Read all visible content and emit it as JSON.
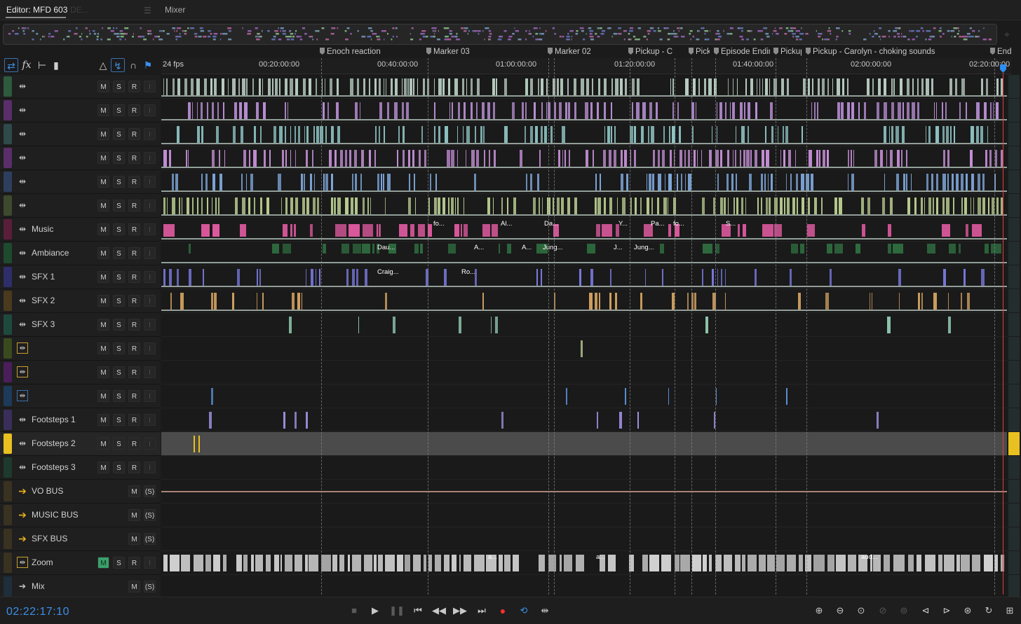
{
  "tabs": [
    {
      "label": "Editor: MFD 603",
      "active": true
    },
    {
      "label": "DE...",
      "active": false
    },
    {
      "label": "Mixer",
      "active": false
    }
  ],
  "header_tools": [
    {
      "icon": "switch-arrows-icon"
    },
    {
      "icon": "fx-icon",
      "label": "fx"
    },
    {
      "icon": "send-icon"
    },
    {
      "icon": "meter-bars-icon"
    },
    {
      "icon": "warning-triangle-icon"
    },
    {
      "icon": "input-monitor-icon"
    },
    {
      "icon": "headphones-icon"
    },
    {
      "icon": "marker-pin-icon"
    }
  ],
  "ruler": {
    "fps_label": "24 fps",
    "ticks": [
      "00:20:00:00",
      "00:40:00:00",
      "01:00:00:00",
      "01:20:00:00",
      "01:40:00:00",
      "02:00:00:00",
      "02:20:00:00"
    ]
  },
  "markers": [
    {
      "label": "Enoch reaction"
    },
    {
      "label": "Marker 03"
    },
    {
      "label": "Marker 02"
    },
    {
      "label": "Pickup - C"
    },
    {
      "label": "Pick"
    },
    {
      "label": "Episode Endin"
    },
    {
      "label": "Pickup"
    },
    {
      "label": "Pickup - Carolyn - choking sounds"
    },
    {
      "label": "End"
    }
  ],
  "tracks": [
    {
      "name": "",
      "type": "audio",
      "color": "#2e5a3e",
      "clip_color": "#b8ccc2"
    },
    {
      "name": "",
      "type": "audio",
      "color": "#5a2e6a",
      "clip_color": "#b98fd6"
    },
    {
      "name": "",
      "type": "audio",
      "color": "#2e4a4a",
      "clip_color": "#8fc4c4"
    },
    {
      "name": "",
      "type": "audio",
      "color": "#5a2e6a",
      "clip_color": "#c58fd6"
    },
    {
      "name": "",
      "type": "audio",
      "color": "#2e3e5e",
      "clip_color": "#7fa8dc"
    },
    {
      "name": "",
      "type": "audio",
      "color": "#3e4a2e",
      "clip_color": "#b8cc8f"
    },
    {
      "name": "Music",
      "type": "audio",
      "color": "#5a1e3a",
      "clip_color": "#e05aa0"
    },
    {
      "name": "Ambiance",
      "type": "audio",
      "color": "#1e4a2e",
      "clip_color": "#3e9a5a"
    },
    {
      "name": "SFX 1",
      "type": "audio",
      "color": "#2e2e6a",
      "clip_color": "#7a7ae0"
    },
    {
      "name": "SFX 2",
      "type": "audio",
      "color": "#4a3a1e",
      "clip_color": "#d0a060"
    },
    {
      "name": "SFX 3",
      "type": "audio",
      "color": "#1e4a3e",
      "clip_color": "#8fc8b0"
    },
    {
      "name": "",
      "type": "audio",
      "color": "#3a4a1e",
      "clip_color": "#b8cc8f"
    },
    {
      "name": "",
      "type": "audio",
      "color": "#4a1e5a",
      "clip_color": "#d080e0"
    },
    {
      "name": "",
      "type": "audio",
      "color": "#1e3a5a",
      "clip_color": "#5a90d8"
    },
    {
      "name": "Footsteps 1",
      "type": "audio",
      "color": "#3a2e5a",
      "clip_color": "#a08fe0"
    },
    {
      "name": "Footsteps 2",
      "type": "audio",
      "color": "#e8c020",
      "clip_color": "#e8c020",
      "selected": true
    },
    {
      "name": "Footsteps 3",
      "type": "audio",
      "color": "#1e3a2e",
      "clip_color": "#8fc8a0"
    },
    {
      "name": "VO BUS",
      "type": "bus",
      "color": "#3a3220"
    },
    {
      "name": "MUSIC BUS",
      "type": "bus",
      "color": "#3a3220"
    },
    {
      "name": "SFX BUS",
      "type": "bus",
      "color": "#3a3220"
    },
    {
      "name": "Zoom",
      "type": "audio",
      "color": "#3a3220",
      "clip_color": "#d0d0d0",
      "mute_on": true
    },
    {
      "name": "Mix",
      "type": "master",
      "color": "#1e2e3a"
    }
  ],
  "buttons": {
    "mute": "M",
    "solo": "S",
    "record": "R",
    "input": "I",
    "solo_safe": "(S)"
  },
  "clip_labels": [
    {
      "track": 6,
      "text": "fo..."
    },
    {
      "track": 6,
      "text": "Al..."
    },
    {
      "track": 6,
      "text": "Da..."
    },
    {
      "track": 6,
      "text": "Y..."
    },
    {
      "track": 6,
      "text": "Pa..."
    },
    {
      "track": 6,
      "text": "fo..."
    },
    {
      "track": 6,
      "text": "S..."
    },
    {
      "track": 7,
      "text": "Dau..."
    },
    {
      "track": 7,
      "text": "A..."
    },
    {
      "track": 7,
      "text": "A..."
    },
    {
      "track": 7,
      "text": "Jung..."
    },
    {
      "track": 7,
      "text": "J..."
    },
    {
      "track": 7,
      "text": "Jung..."
    },
    {
      "track": 8,
      "text": "Craig..."
    },
    {
      "track": 8,
      "text": "Ro..."
    },
    {
      "track": 20,
      "text": "a..."
    },
    {
      "track": 20,
      "text": "a..."
    },
    {
      "track": 20,
      "text": "aud..."
    }
  ],
  "timecode": "02:22:17:10",
  "transport": [
    {
      "icon": "stop-icon",
      "enabled": false
    },
    {
      "icon": "play-icon",
      "enabled": true
    },
    {
      "icon": "pause-icon",
      "enabled": false
    },
    {
      "icon": "go-to-start-icon",
      "enabled": true
    },
    {
      "icon": "rewind-icon",
      "enabled": true
    },
    {
      "icon": "fast-forward-icon",
      "enabled": true
    },
    {
      "icon": "go-to-end-icon",
      "enabled": true
    },
    {
      "icon": "record-icon",
      "enabled": true
    },
    {
      "icon": "loop-icon",
      "enabled": true
    },
    {
      "icon": "skip-selection-icon",
      "enabled": true
    }
  ],
  "zoom_tools": [
    {
      "icon": "zoom-in-amplitude-icon"
    },
    {
      "icon": "zoom-out-amplitude-icon"
    },
    {
      "icon": "zoom-to-selection-icon"
    },
    {
      "icon": "zoom-out-selection-icon"
    },
    {
      "icon": "zoom-playhead-icon"
    },
    {
      "icon": "zoom-in-left-icon"
    },
    {
      "icon": "zoom-out-left-icon"
    },
    {
      "icon": "zoom-in-right-icon"
    },
    {
      "icon": "zoom-reset-icon"
    },
    {
      "icon": "zoom-full-icon"
    }
  ]
}
